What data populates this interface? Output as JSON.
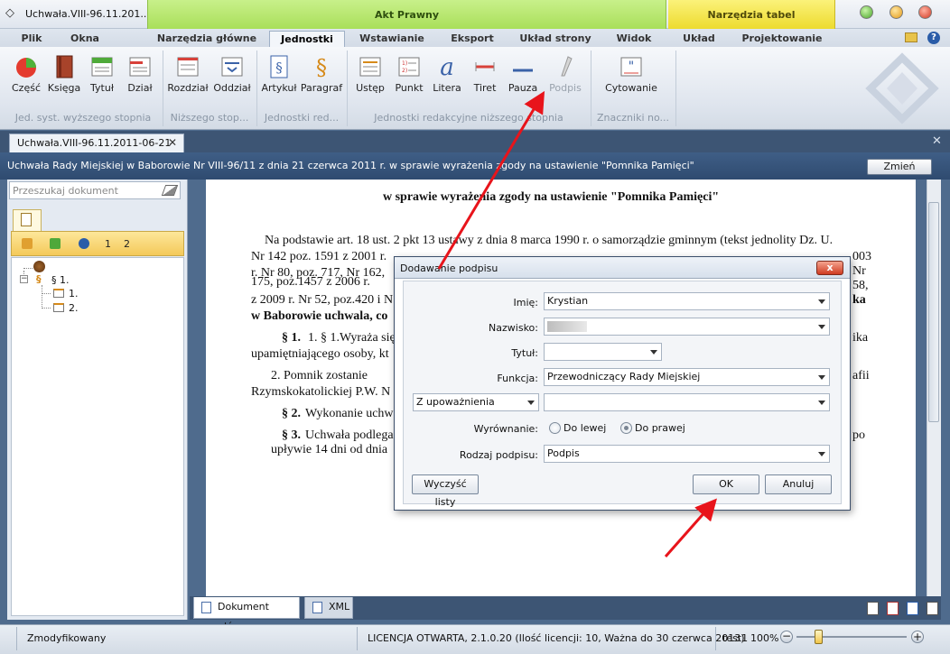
{
  "window": {
    "title": "Uchwała.VIII-96.11.201...",
    "context_group_1": "Akt Prawny",
    "context_group_2": "Narzędzia tabel"
  },
  "ribbon_tabs": [
    "Plik",
    "Okna",
    "Narzędzia główne",
    "Jednostki",
    "Wstawianie",
    "Eksport",
    "Układ strony",
    "Widok",
    "Układ",
    "Projektowanie"
  ],
  "active_tab": "Jednostki",
  "ribbon": {
    "buttons": {
      "czesc": "Część",
      "ksiega": "Księga",
      "tytul": "Tytuł",
      "dzial": "Dział",
      "rozdzial": "Rozdział",
      "oddzial": "Oddział",
      "artykul": "Artykuł",
      "paragraf": "Paragraf",
      "ustep": "Ustęp",
      "punkt": "Punkt",
      "litera": "Litera",
      "tiret": "Tiret",
      "pauza": "Pauza",
      "podpis": "Podpis",
      "cytowanie": "Cytowanie"
    },
    "groups": {
      "g1": "Jed. syst. wyższego stopnia",
      "g2": "Niższego stop...",
      "g3": "Jednostki red...",
      "g4": "Jednostki redakcyjne niższego stopnia",
      "g5": "Znaczniki no..."
    }
  },
  "doc_tab": "Uchwała.VIII-96.11.2011-06-21",
  "doc_header": {
    "title": "Uchwała Rady Miejskiej w Baborowie Nr VIII-96/11 z dnia 21 czerwca 2011 r. w sprawie wyrażenia zgody na ustawienie \"Pomnika Pamięci\"",
    "change_button": "Zmień"
  },
  "left_panel": {
    "search_placeholder": "Przeszukaj dokument",
    "strip_numbers": [
      "1",
      "2"
    ],
    "tree": [
      "§ 1.",
      "1.",
      "2."
    ]
  },
  "document": {
    "heading": "w sprawie wyrażenia zgody na ustawienie \"Pomnika Pamięci\"",
    "lines": [
      "Na podstawie art. 18 ust. 2 pkt 13 ustawy z dnia 8 marca 1990 r. o samorządzie gminnym (tekst jednolity Dz. U.",
      "Nr 142 poz. 1591 z 2001 r.",
      "r. Nr 80, poz. 717, Nr 162,",
      "175, poz.1457 z 2006 r.",
      "z 2009 r. Nr 52, poz.420 i N"
    ],
    "bold_tail_1": "w Baborowie uchwala, co",
    "par1_a": "§ 1.",
    "par1_b": "1. § 1.Wyraża  się",
    "par1_c": "upamiętniającego osoby, kt",
    "par1_d": "2. Pomnik  zostanie",
    "par1_e": "Rzymskokatolickiej P.W. N",
    "par2_a": "§ 2.",
    "par2_b": "Wykonanie uchw",
    "par3_a": "§ 3.",
    "par3_b": "Uchwała podlega",
    "par3_c": "upływie 14 dni od dnia",
    "right_fragments": {
      "r1": "003",
      "r2": "Nr",
      "r3": "58,",
      "r4": "ka",
      "r5": "ika",
      "r6": "afii",
      "r7": "po"
    }
  },
  "bottom_tabs": [
    "Dokument główny",
    "XML"
  ],
  "dialog": {
    "title": "Dodawanie podpisu",
    "close_label": "x",
    "labels": {
      "imie": "Imię:",
      "nazwisko": "Nazwisko:",
      "tytul": "Tytuł:",
      "funkcja": "Funkcja:",
      "wyrownanie": "Wyrównanie:",
      "rodzaj": "Rodzaj podpisu:"
    },
    "values": {
      "imie": "Krystian",
      "nazwisko": "",
      "tytul": "",
      "funkcja": "Przewodniczący Rady Miejskiej",
      "upowaznienie": "Z upoważnienia",
      "upowaznienie_value": "",
      "rodzaj": "Podpis"
    },
    "alignment_options": [
      "Do lewej",
      "Do prawej"
    ],
    "alignment_selected": "Do prawej",
    "buttons": {
      "clear": "Wyczyść listy",
      "ok": "OK",
      "cancel": "Anuluj"
    }
  },
  "status": {
    "left": "Zmodyfikowany",
    "license": "LICENCJA OTWARTA, 2.1.0.20 (Ilość licencji: 10, Ważna do 30 czerwca 2013)",
    "user": "test1",
    "zoom": "100%",
    "zoom_fraction": 0.2
  },
  "colors": {
    "accent_green": "#a9df5a",
    "accent_yellow": "#eddb2e",
    "header_blue": "#2f4b70",
    "annotation_arrow": "#e8141b"
  }
}
